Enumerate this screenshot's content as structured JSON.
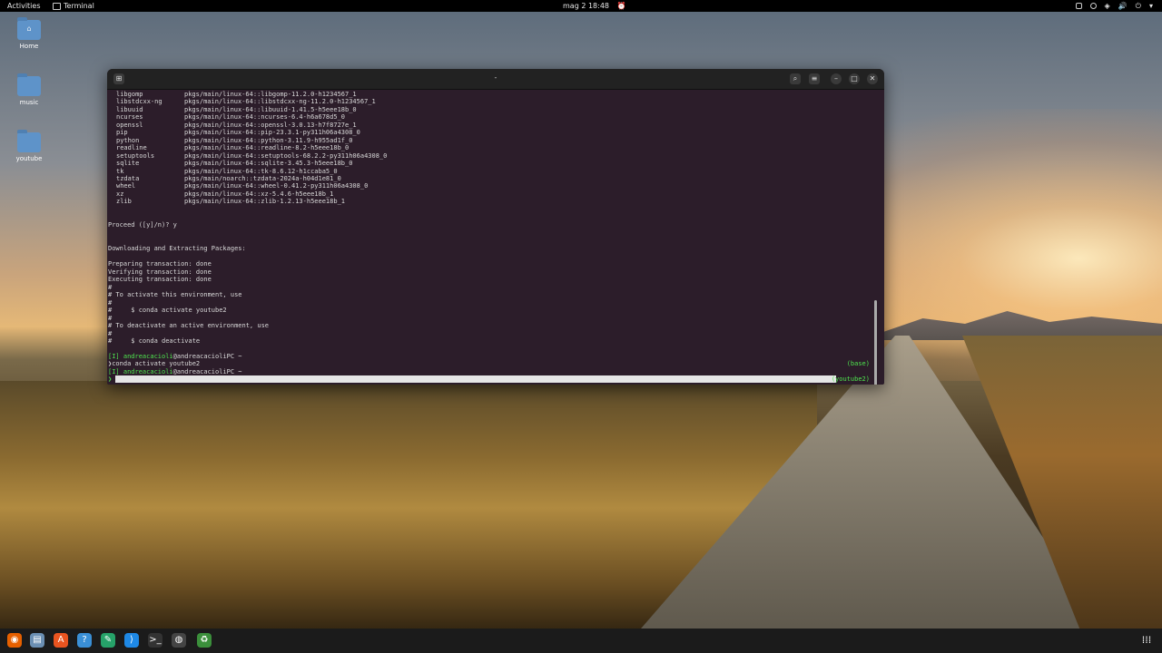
{
  "topbar": {
    "activities": "Activities",
    "app_name": "Terminal",
    "clock": "mag 2  18:48"
  },
  "desktop": {
    "icons": [
      {
        "label": "Home"
      },
      {
        "label": "music"
      },
      {
        "label": "youtube"
      }
    ]
  },
  "terminal": {
    "title": "-",
    "packages": [
      {
        "name": "libgomp",
        "src": "pkgs/main/linux-64::libgomp-11.2.0-h1234567_1"
      },
      {
        "name": "libstdcxx-ng",
        "src": "pkgs/main/linux-64::libstdcxx-ng-11.2.0-h1234567_1"
      },
      {
        "name": "libuuid",
        "src": "pkgs/main/linux-64::libuuid-1.41.5-h5eee18b_0"
      },
      {
        "name": "ncurses",
        "src": "pkgs/main/linux-64::ncurses-6.4-h6a678d5_0"
      },
      {
        "name": "openssl",
        "src": "pkgs/main/linux-64::openssl-3.0.13-h7f8727e_1"
      },
      {
        "name": "pip",
        "src": "pkgs/main/linux-64::pip-23.3.1-py311h06a4308_0"
      },
      {
        "name": "python",
        "src": "pkgs/main/linux-64::python-3.11.9-h955ad1f_0"
      },
      {
        "name": "readline",
        "src": "pkgs/main/linux-64::readline-8.2-h5eee18b_0"
      },
      {
        "name": "setuptools",
        "src": "pkgs/main/linux-64::setuptools-68.2.2-py311h06a4308_0"
      },
      {
        "name": "sqlite",
        "src": "pkgs/main/linux-64::sqlite-3.45.3-h5eee18b_0"
      },
      {
        "name": "tk",
        "src": "pkgs/main/linux-64::tk-8.6.12-h1ccaba5_0"
      },
      {
        "name": "tzdata",
        "src": "pkgs/main/noarch::tzdata-2024a-h04d1e81_0"
      },
      {
        "name": "wheel",
        "src": "pkgs/main/linux-64::wheel-0.41.2-py311h06a4308_0"
      },
      {
        "name": "xz",
        "src": "pkgs/main/linux-64::xz-5.4.6-h5eee18b_1"
      },
      {
        "name": "zlib",
        "src": "pkgs/main/linux-64::zlib-1.2.13-h5eee18b_1"
      }
    ],
    "lines": {
      "proceed": "Proceed ([y]/n)? y",
      "downloading": "Downloading and Extracting Packages:",
      "preparing": "Preparing transaction: done",
      "verifying": "Verifying transaction: done",
      "executing": "Executing transaction: done",
      "hash1": "#",
      "activate_hint": "# To activate this environment, use",
      "hash2": "#",
      "activate_cmd": "#     $ conda activate youtube2",
      "hash3": "#",
      "deactivate_hint": "# To deactivate an active environment, use",
      "hash4": "#",
      "deactivate_cmd": "#     $ conda deactivate"
    },
    "prompt1_user": "[I] andreacacioli",
    "prompt1_host": "@andreacacioliPC ~",
    "prompt1_env": "(base)",
    "command": "❯conda activate youtube2",
    "prompt2_user": "[I] andreacacioli",
    "prompt2_host": "@andreacacioliPC ~",
    "prompt3_env": "(youtube2)",
    "prompt_glyph": "❯"
  },
  "dock": {
    "items": [
      {
        "icon": "firefox-icon",
        "color": "#e66000"
      },
      {
        "icon": "files-icon",
        "color": "#6b8fb3"
      },
      {
        "icon": "software-icon",
        "color": "#e95420"
      },
      {
        "icon": "help-icon",
        "color": "#3a8fd6"
      },
      {
        "icon": "edit-icon",
        "color": "#26a269"
      },
      {
        "icon": "vscode-icon",
        "color": "#1e88e5"
      },
      {
        "icon": "terminal-icon",
        "color": "#333333"
      },
      {
        "icon": "obs-icon",
        "color": "#444444"
      },
      {
        "icon": "trash-icon",
        "color": "#3b8f3b"
      }
    ]
  }
}
